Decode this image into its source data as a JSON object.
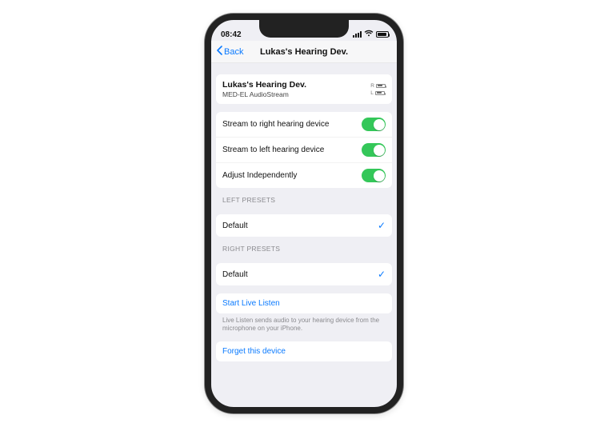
{
  "status": {
    "time": "08:42"
  },
  "nav": {
    "back": "Back",
    "title": "Lukas's Hearing Dev."
  },
  "device": {
    "title": "Lukas's Hearing Dev.",
    "subtitle": "MED-EL AudioStream",
    "right_label": "R",
    "left_label": "L"
  },
  "toggles": {
    "stream_right": "Stream to right hearing device",
    "stream_left": "Stream to left hearing device",
    "adjust_independently": "Adjust Independently"
  },
  "left_presets": {
    "header": "LEFT PRESETS",
    "selected": "Default"
  },
  "right_presets": {
    "header": "RIGHT PRESETS",
    "selected": "Default"
  },
  "live_listen": {
    "action": "Start Live Listen",
    "note": "Live Listen sends audio to your hearing device from the microphone on your iPhone."
  },
  "forget": {
    "action": "Forget this device"
  }
}
